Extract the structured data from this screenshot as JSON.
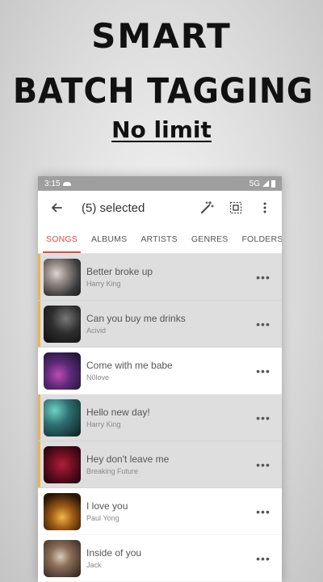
{
  "promo": {
    "line1": "SMART",
    "line2": "BATCH TAGGING",
    "line3": "No limit"
  },
  "status_bar": {
    "time": "3:15",
    "network": "5G"
  },
  "app_bar": {
    "title": "(5) selected",
    "icons": [
      "back-arrow-icon",
      "magic-wand-icon",
      "select-all-icon",
      "more-vertical-icon"
    ]
  },
  "tabs": [
    {
      "label": "SONGS",
      "active": true
    },
    {
      "label": "ALBUMS",
      "active": false
    },
    {
      "label": "ARTISTS",
      "active": false
    },
    {
      "label": "GENRES",
      "active": false
    },
    {
      "label": "FOLDERS",
      "active": false
    }
  ],
  "songs": [
    {
      "title": "Better broke up",
      "artist": "Harry King",
      "selected": true
    },
    {
      "title": "Can you buy me drinks",
      "artist": "Acivid",
      "selected": true
    },
    {
      "title": "Come with me babe",
      "artist": "N0love",
      "selected": false
    },
    {
      "title": "Hello new day!",
      "artist": "Harry King",
      "selected": true
    },
    {
      "title": "Hey don't leave me",
      "artist": "Breaking Future",
      "selected": true
    },
    {
      "title": "I love you",
      "artist": "Paul Yong",
      "selected": false
    },
    {
      "title": "Inside of you",
      "artist": "Jack",
      "selected": false
    }
  ],
  "row_more_label": "•••",
  "colors": {
    "accent": "#e0483f",
    "selection_bar": "#e8b64d",
    "selected_row": "#dedede"
  }
}
